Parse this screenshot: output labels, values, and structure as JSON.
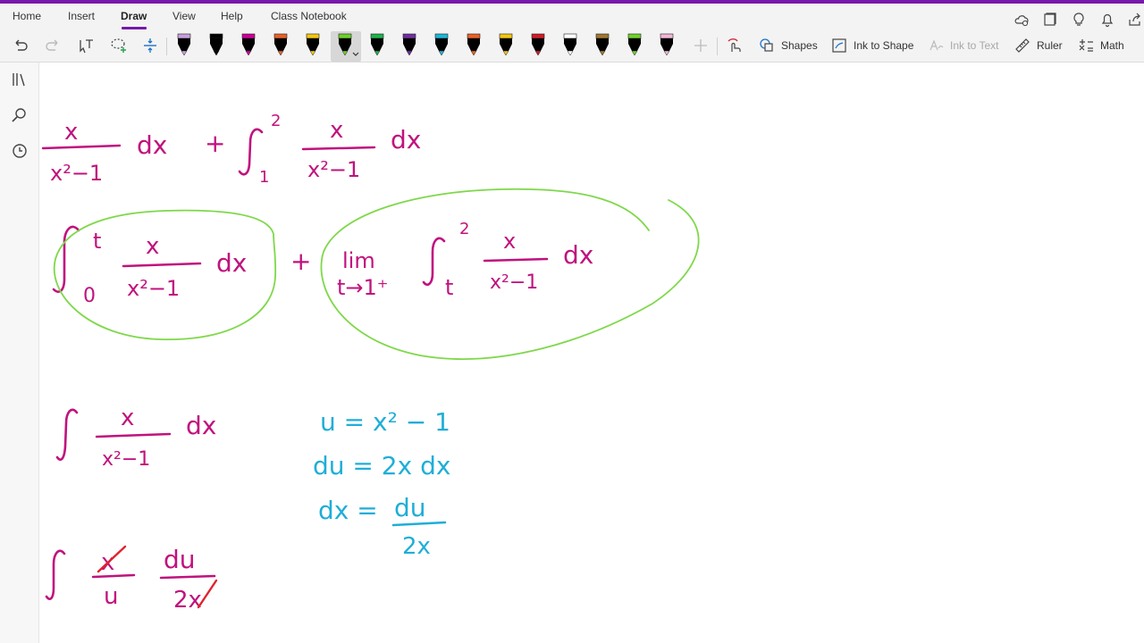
{
  "menu": {
    "tabs": [
      "Home",
      "Insert",
      "Draw",
      "View",
      "Help",
      "Class Notebook"
    ],
    "active_tab": "Draw"
  },
  "toolbar": {
    "pens": [
      {
        "color": "#000000",
        "tip": "#c9a0dc"
      },
      {
        "color": "#000000",
        "tip": "#000000"
      },
      {
        "color": "#000000",
        "tip": "#cc0099"
      },
      {
        "color": "#000000",
        "tip": "#e8622a"
      },
      {
        "color": "#000000",
        "tip": "#f2c811"
      },
      {
        "color": "#000000",
        "tip": "#6fd22c",
        "selected": true
      },
      {
        "color": "#000000",
        "tip": "#22b24c"
      },
      {
        "color": "#000000",
        "tip": "#7030a0"
      },
      {
        "color": "#000000",
        "tip": "#1fb6d8"
      },
      {
        "color": "#000000",
        "tip": "#e8622a"
      },
      {
        "color": "#000000",
        "tip": "#f2c811"
      },
      {
        "color": "#000000",
        "tip": "#d01c2c"
      },
      {
        "color": "#000000",
        "tip": "#ffffff"
      },
      {
        "color": "#000000",
        "tip": "#a07830"
      },
      {
        "color": "#000000",
        "tip": "#6fd22c"
      },
      {
        "color": "#000000",
        "tip": "#f2b8d8"
      }
    ],
    "shapes_label": "Shapes",
    "ink_to_shape_label": "Ink to Shape",
    "ink_to_text_label": "Ink to Text",
    "ruler_label": "Ruler",
    "math_label": "Math"
  },
  "ink": {
    "colors": {
      "magenta": "#c0127e",
      "green": "#7ed84a",
      "cyan": "#1faed8",
      "red": "#e0222e"
    },
    "line1": {
      "num": "x",
      "den": "x²−1",
      "dx": "dx",
      "plus": "+",
      "upper": "2",
      "lower": "1"
    },
    "line2": {
      "upper_a": "t",
      "lower_a": "0",
      "num": "x",
      "den": "x²−1",
      "dx": "dx",
      "plus": "+",
      "lim": "lim",
      "lim_sub": "t→1⁺",
      "upper_b": "2",
      "lower_b": "t"
    },
    "line3": {
      "num": "x",
      "den": "x²−1",
      "dx": "dx"
    },
    "sub": {
      "l1": "u = x² − 1",
      "l2": "du = 2x dx",
      "l3a": "dx = ",
      "l3num": "du",
      "l3den": "2x"
    },
    "line4": {
      "num": "x",
      "den": "u",
      "num2": "du",
      "den2": "2x"
    }
  }
}
